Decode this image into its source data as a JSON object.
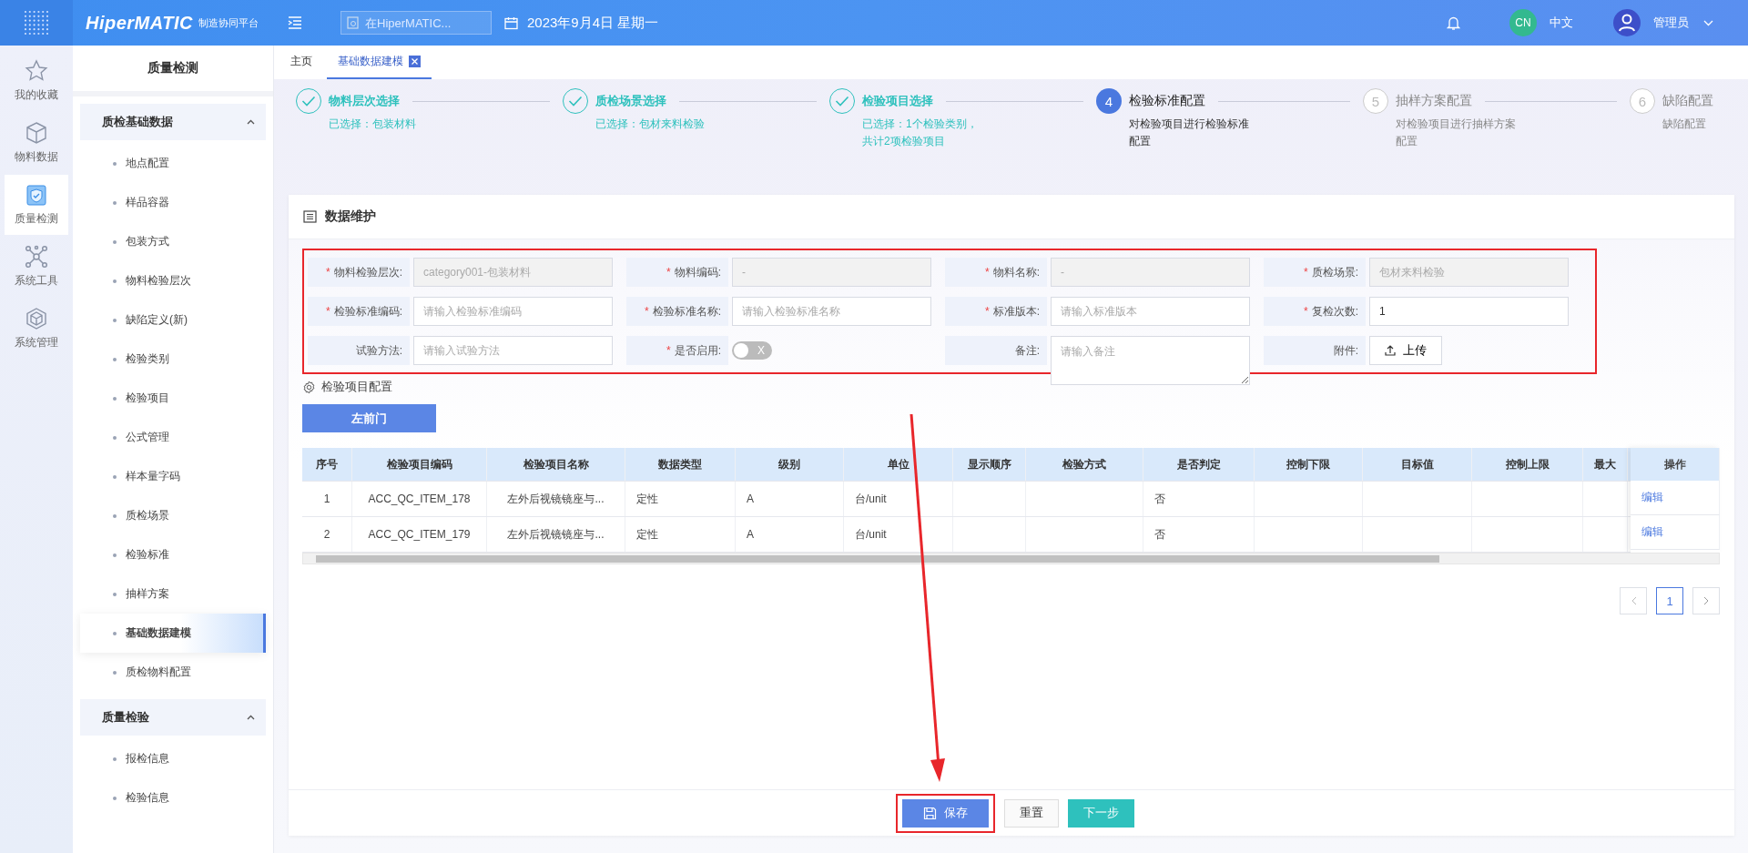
{
  "header": {
    "logo": "HiperMATIC",
    "logo_sub": "制造协同平台",
    "search": {
      "placeholder": "在HiperMATIC..."
    },
    "date": "2023年9月4日 星期一",
    "avatar": "CN",
    "language": "中文",
    "user": "管理员"
  },
  "rail": [
    {
      "kind": "star",
      "label": "我的收藏",
      "selected": false
    },
    {
      "kind": "cube",
      "label": "物料数据",
      "selected": false
    },
    {
      "kind": "shield",
      "label": "质量检测",
      "selected": true
    },
    {
      "kind": "network",
      "label": "系统工具",
      "selected": false
    },
    {
      "kind": "hexagon",
      "label": "系统管理",
      "selected": false
    }
  ],
  "sidebar": {
    "title": "质量检测",
    "groups": [
      {
        "label": "质检基础数据",
        "expanded": true,
        "items": [
          {
            "label": "地点配置",
            "selected": false
          },
          {
            "label": "样品容器",
            "selected": false
          },
          {
            "label": "包装方式",
            "selected": false
          },
          {
            "label": "物料检验层次",
            "selected": false
          },
          {
            "label": "缺陷定义(新)",
            "selected": false
          },
          {
            "label": "检验类别",
            "selected": false
          },
          {
            "label": "检验项目",
            "selected": false
          },
          {
            "label": "公式管理",
            "selected": false
          },
          {
            "label": "样本量字码",
            "selected": false
          },
          {
            "label": "质检场景",
            "selected": false
          },
          {
            "label": "检验标准",
            "selected": false
          },
          {
            "label": "抽样方案",
            "selected": false
          },
          {
            "label": "基础数据建模",
            "selected": true
          },
          {
            "label": "质检物料配置",
            "selected": false
          }
        ]
      },
      {
        "label": "质量检验",
        "expanded": true,
        "items": [
          {
            "label": "报检信息",
            "selected": false
          },
          {
            "label": "检验信息",
            "selected": false
          }
        ]
      }
    ]
  },
  "tabs": [
    {
      "label": "主页",
      "selected": false,
      "closable": false
    },
    {
      "label": "基础数据建模",
      "selected": true,
      "closable": true
    }
  ],
  "steps": [
    {
      "completed": true,
      "title": "物料层次选择",
      "description": "已选择：包装材料"
    },
    {
      "completed": true,
      "title": "质检场景选择",
      "description": "已选择：包材来料检验"
    },
    {
      "completed": true,
      "title": "检验项目选择",
      "description": "已选择：1个检验类别，共计2项检验项目"
    },
    {
      "completed": false,
      "current": true,
      "number": "4",
      "title": "检验标准配置",
      "description": "对检验项目进行检验标准配置"
    },
    {
      "completed": false,
      "current": false,
      "number": "5",
      "title": "抽样方案配置",
      "description": "对检验项目进行抽样方案配置"
    },
    {
      "completed": false,
      "current": false,
      "number": "6",
      "title": "缺陷配置",
      "description": "缺陷配置"
    }
  ],
  "card": {
    "title": "数据维护",
    "fields": [
      {
        "kind": "input",
        "label": "物料检验层次:",
        "required": "*",
        "disabled": true,
        "value": "category001-包装材料"
      },
      {
        "kind": "input",
        "label": "物料编码:",
        "required": "*",
        "disabled": true,
        "value": "-"
      },
      {
        "kind": "input",
        "label": "物料名称:",
        "required": "*",
        "disabled": true,
        "value": "-"
      },
      {
        "kind": "input",
        "label": "质检场景:",
        "required": "*",
        "disabled": true,
        "value": "包材来料检验"
      },
      {
        "kind": "input",
        "label": "检验标准编码:",
        "required": "*",
        "disabled": false,
        "placeholder": "请输入检验标准编码"
      },
      {
        "kind": "input",
        "label": "检验标准名称:",
        "required": "*",
        "disabled": false,
        "placeholder": "请输入检验标准名称"
      },
      {
        "kind": "input",
        "label": "标准版本:",
        "required": "*",
        "disabled": false,
        "placeholder": "请输入标准版本"
      },
      {
        "kind": "input",
        "label": "复检次数:",
        "required": "*",
        "disabled": false,
        "value": "1"
      },
      {
        "kind": "input",
        "label": "试验方法:",
        "disabled": false,
        "placeholder": "请输入试验方法"
      },
      {
        "kind": "switch",
        "label": "是否启用:",
        "required": "*",
        "on": false,
        "off_text": "X"
      },
      {
        "kind": "textarea",
        "label": "备注:",
        "placeholder": "请输入备注"
      },
      {
        "kind": "upload",
        "label": "附件:",
        "button": "上传"
      }
    ],
    "section_title": "检验项目配置",
    "group_button": "左前门",
    "table": {
      "columns": [
        "序号",
        "检验项目编码",
        "检验项目名称",
        "数据类型",
        "级别",
        "单位",
        "显示顺序",
        "检验方式",
        "是否判定",
        "控制下限",
        "目标值",
        "控制上限",
        "最大"
      ],
      "action_column": "操作",
      "rows": [
        {
          "cells": [
            "1",
            "ACC_QC_ITEM_178",
            "左外后视镜镜座与...",
            "定性",
            "A",
            "台/unit",
            null,
            null,
            "否",
            null,
            null,
            null,
            null
          ],
          "action": "编辑"
        },
        {
          "cells": [
            "2",
            "ACC_QC_ITEM_179",
            "左外后视镜镜座与...",
            "定性",
            "A",
            "台/unit",
            null,
            null,
            "否",
            null,
            null,
            null,
            null
          ],
          "action": "编辑"
        }
      ]
    },
    "pagination": [
      {
        "label": "1",
        "selected": true
      }
    ],
    "buttons": [
      {
        "kind": "primary",
        "label": "保存"
      },
      {
        "kind": "default",
        "label": "重置"
      },
      {
        "kind": "success",
        "label": "下一步"
      }
    ]
  }
}
